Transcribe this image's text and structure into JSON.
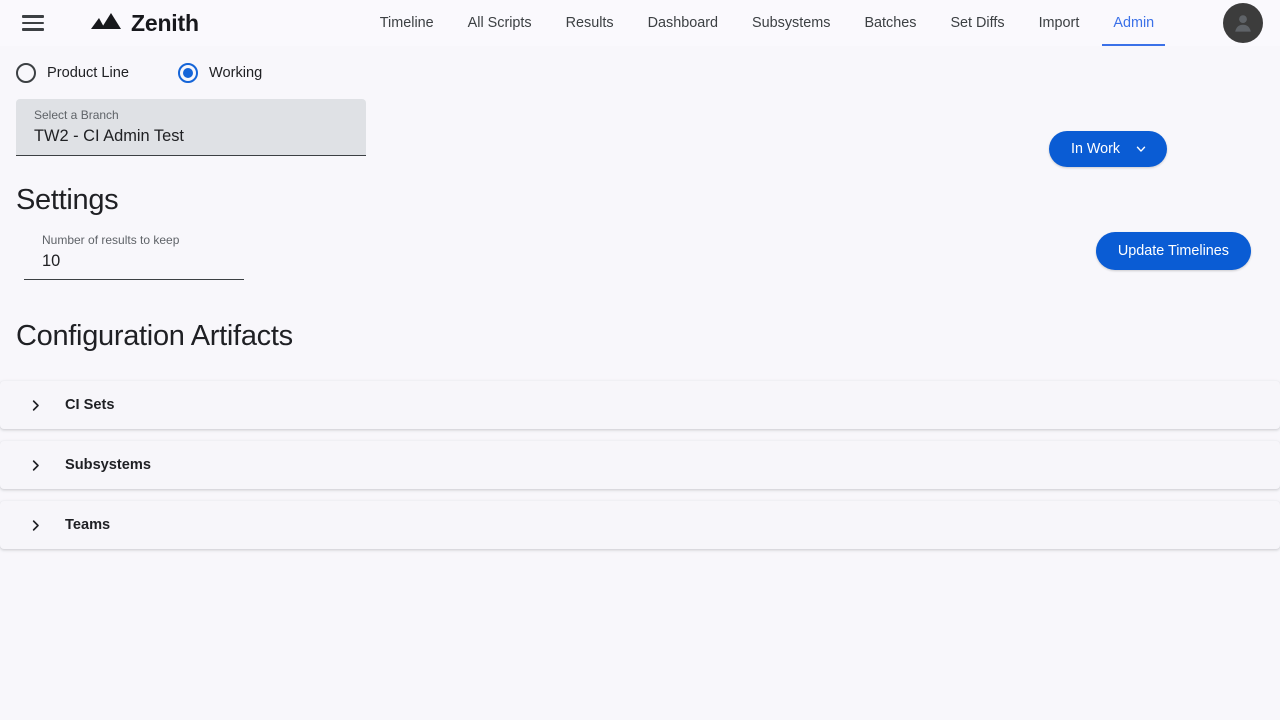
{
  "header": {
    "menu_icon": "hamburger-icon",
    "brand_name": "Zenith",
    "brand_logo_icon": "mountain-logo-icon",
    "nav_items": [
      {
        "label": "Timeline",
        "active": false
      },
      {
        "label": "All Scripts",
        "active": false
      },
      {
        "label": "Results",
        "active": false
      },
      {
        "label": "Dashboard",
        "active": false
      },
      {
        "label": "Subsystems",
        "active": false
      },
      {
        "label": "Batches",
        "active": false
      },
      {
        "label": "Set Diffs",
        "active": false
      },
      {
        "label": "Import",
        "active": false
      },
      {
        "label": "Admin",
        "active": true
      }
    ],
    "avatar_icon": "account-circle-icon"
  },
  "scope": {
    "radios": [
      {
        "label": "Product Line",
        "checked": false
      },
      {
        "label": "Working",
        "checked": true
      }
    ],
    "branch_field": {
      "label": "Select a Branch",
      "value": "TW2 - CI Admin Test"
    },
    "status_button": {
      "label": "In Work",
      "chevron_icon": "chevron-down-icon"
    }
  },
  "settings": {
    "title": "Settings",
    "results_to_keep": {
      "label": "Number of results to keep",
      "value": "10"
    },
    "update_button": "Update Timelines"
  },
  "artifacts": {
    "title": "Configuration Artifacts",
    "panels": [
      {
        "label": "CI Sets",
        "chevron_icon": "chevron-right-icon",
        "expanded": false
      },
      {
        "label": "Subsystems",
        "chevron_icon": "chevron-right-icon",
        "expanded": false
      },
      {
        "label": "Teams",
        "chevron_icon": "chevron-right-icon",
        "expanded": false
      }
    ]
  },
  "colors": {
    "accent_blue": "#0a5cd4",
    "nav_active_blue": "#3b71e8",
    "radio_blue": "#1565d8",
    "page_background": "#f8f7fb",
    "field_fill": "#dfe1e5"
  }
}
